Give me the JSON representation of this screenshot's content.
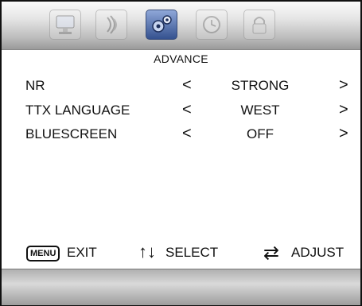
{
  "menu": {
    "title": "ADVANCE",
    "tabs": [
      {
        "icon": "monitor-icon",
        "active": false
      },
      {
        "icon": "sound-icon",
        "active": false
      },
      {
        "icon": "gears-icon",
        "active": true
      },
      {
        "icon": "clock-icon",
        "active": false
      },
      {
        "icon": "lock-icon",
        "active": false
      }
    ],
    "items": [
      {
        "label": "NR",
        "value": "STRONG",
        "left": "<",
        "right": ">"
      },
      {
        "label": "TTX LANGUAGE",
        "value": "WEST",
        "left": "<",
        "right": ">"
      },
      {
        "label": "BLUESCREEN",
        "value": "OFF",
        "left": "<",
        "right": ">"
      }
    ]
  },
  "footer": {
    "menu_key": "MENU",
    "exit": "EXIT",
    "updown_arrows": "↑↓",
    "select": "SELECT",
    "adjust_arrows": "⇄",
    "adjust": "ADJUST"
  }
}
